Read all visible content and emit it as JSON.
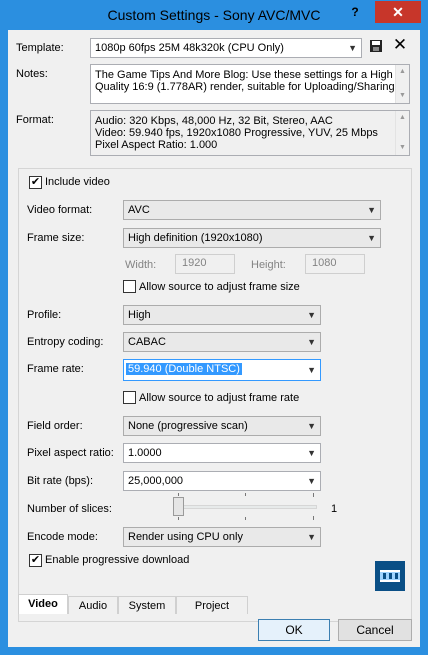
{
  "window": {
    "title": "Custom Settings - Sony AVC/MVC",
    "help_glyph": "?",
    "close_glyph": "✕"
  },
  "template": {
    "label": "Template:",
    "value": "1080p  60fps 25M  48k320k (CPU Only)"
  },
  "notes": {
    "label": "Notes:",
    "line1": "The Game Tips And More Blog: Use these settings for a High",
    "line2": "Quality 16:9 (1.778AR) render, suitable for Uploading/Sharing"
  },
  "format": {
    "label": "Format:",
    "line1": "Audio: 320 Kbps, 48,000 Hz, 32 Bit, Stereo, AAC",
    "line2": "Video: 59.940 fps, 1920x1080 Progressive, YUV, 25 Mbps",
    "line3": "Pixel Aspect Ratio: 1.000"
  },
  "video": {
    "include_video": "Include video",
    "video_format": {
      "label": "Video format:",
      "value": "AVC"
    },
    "frame_size": {
      "label": "Frame size:",
      "value": "High definition (1920x1080)"
    },
    "width": {
      "label": "Width:",
      "value": "1920"
    },
    "height": {
      "label": "Height:",
      "value": "1080"
    },
    "allow_frame_size": "Allow source to adjust frame size",
    "profile": {
      "label": "Profile:",
      "value": "High"
    },
    "entropy": {
      "label": "Entropy coding:",
      "value": "CABAC"
    },
    "frame_rate": {
      "label": "Frame rate:",
      "value": "59.940 (Double NTSC)"
    },
    "allow_frame_rate": "Allow source to adjust frame rate",
    "field_order": {
      "label": "Field order:",
      "value": "None (progressive scan)"
    },
    "pixel_aspect": {
      "label": "Pixel aspect ratio:",
      "value": "1.0000"
    },
    "bit_rate": {
      "label": "Bit rate (bps):",
      "value": "25,000,000"
    },
    "slices": {
      "label": "Number of slices:",
      "value": "1"
    },
    "encode_mode": {
      "label": "Encode mode:",
      "value": "Render using CPU only"
    },
    "progressive_download": "Enable progressive download"
  },
  "tabs": [
    "Video",
    "Audio",
    "System",
    "Project"
  ],
  "buttons": {
    "ok": "OK",
    "cancel": "Cancel"
  },
  "colors": {
    "titlebar": "#2b8fe0",
    "close": "#c7362a",
    "selection": "#3399ff"
  }
}
